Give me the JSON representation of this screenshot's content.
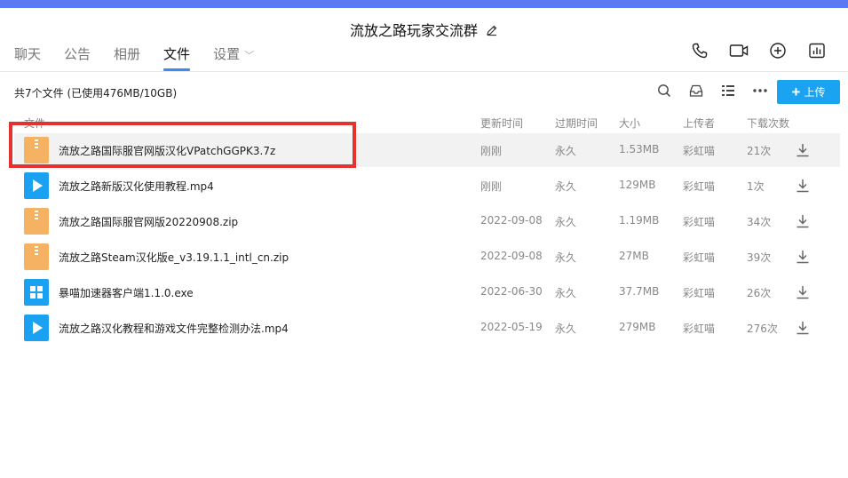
{
  "header": {
    "title": "流放之路玩家交流群",
    "tabs": [
      {
        "label": "聊天",
        "active": false
      },
      {
        "label": "公告",
        "active": false
      },
      {
        "label": "相册",
        "active": false
      },
      {
        "label": "文件",
        "active": true
      },
      {
        "label": "设置",
        "active": false,
        "has_dropdown": true
      }
    ],
    "icons": [
      "phone-icon",
      "video-call-icon",
      "add-circle-icon",
      "stats-icon"
    ]
  },
  "toolbar": {
    "summary": "共7个文件 (已使用476MB/10GB)",
    "icons": [
      "search-icon",
      "inbox-icon",
      "list-view-icon",
      "more-icon"
    ],
    "upload_label": "上传"
  },
  "table": {
    "columns": {
      "name": "文件",
      "updated": "更新时间",
      "expiry": "过期时间",
      "size": "大小",
      "uploader": "上传者",
      "downloads": "下载次数"
    },
    "rows": [
      {
        "type": "zip",
        "name": "流放之路国际服官网版汉化VPatchGGPK3.7z",
        "updated": "刚刚",
        "expiry": "永久",
        "size": "1.53MB",
        "uploader": "彩虹喵",
        "downloads": "21次",
        "highlighted": true
      },
      {
        "type": "video",
        "name": "流放之路新版汉化使用教程.mp4",
        "updated": "刚刚",
        "expiry": "永久",
        "size": "129MB",
        "uploader": "彩虹喵",
        "downloads": "1次"
      },
      {
        "type": "zip",
        "name": "流放之路国际服官网版20220908.zip",
        "updated": "2022-09-08",
        "expiry": "永久",
        "size": "1.19MB",
        "uploader": "彩虹喵",
        "downloads": "34次"
      },
      {
        "type": "zip",
        "name": "流放之路Steam汉化版e_v3.19.1.1_intl_cn.zip",
        "updated": "2022-09-08",
        "expiry": "永久",
        "size": "27MB",
        "uploader": "彩虹喵",
        "downloads": "39次"
      },
      {
        "type": "exe",
        "name": "暴喵加速器客户端1.1.0.exe",
        "updated": "2022-06-30",
        "expiry": "永久",
        "size": "37.7MB",
        "uploader": "彩虹喵",
        "downloads": "26次"
      },
      {
        "type": "video",
        "name": "流放之路汉化教程和游戏文件完整检测办法.mp4",
        "updated": "2022-05-19",
        "expiry": "永久",
        "size": "279MB",
        "uploader": "彩虹喵",
        "downloads": "276次"
      }
    ]
  },
  "colors": {
    "accent_bar": "#5a79f2",
    "upload_button": "#1aa3f0",
    "tab_underline": "#3c8cf0",
    "zip_icon": "#f5b263",
    "media_icon": "#1ba1f2",
    "annotation_box": "#e5322e"
  }
}
